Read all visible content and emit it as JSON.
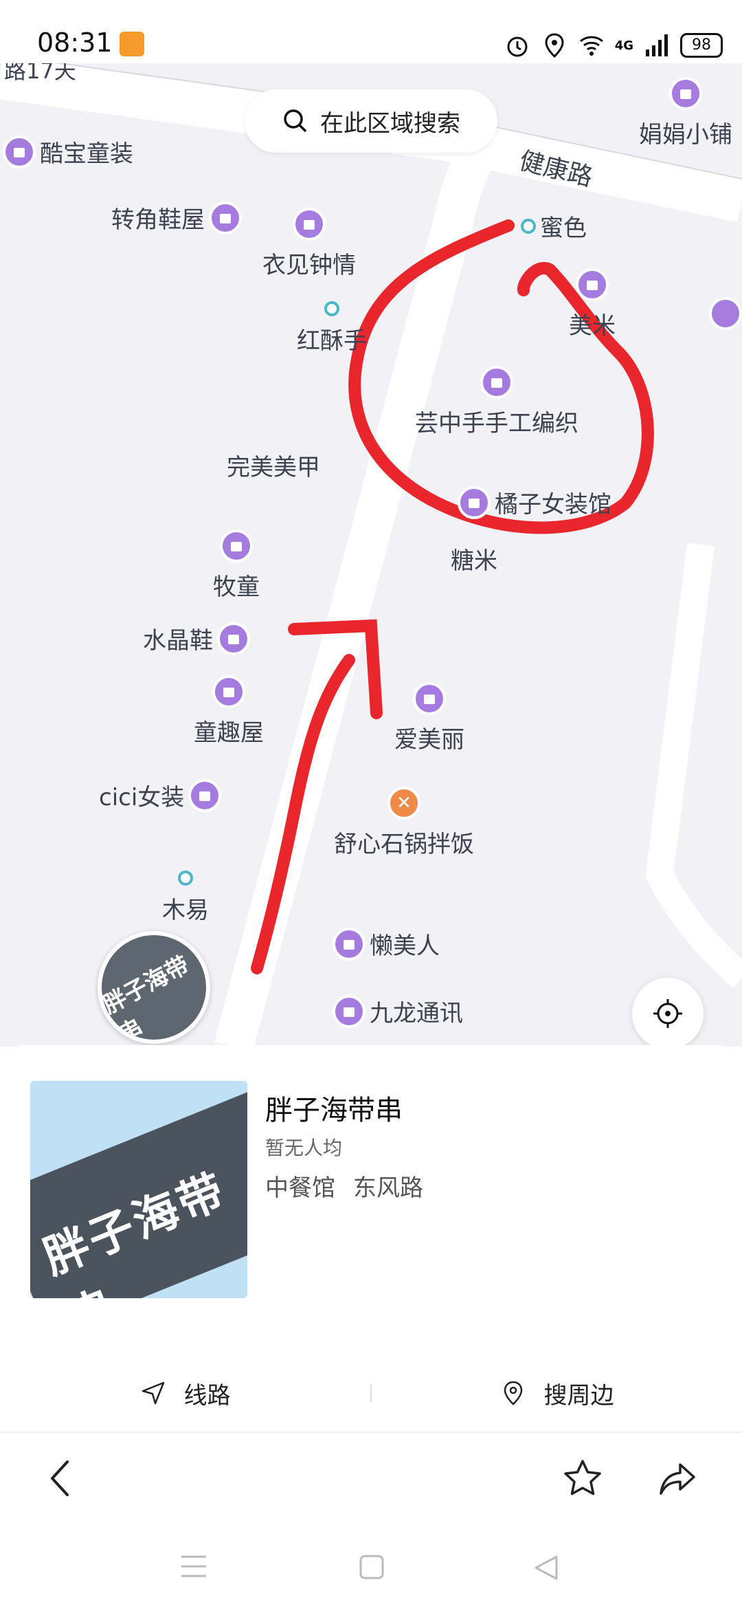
{
  "status_bar": {
    "time": "08:31",
    "network": "4G",
    "battery": "98"
  },
  "map": {
    "search_button_label": "在此区域搜索",
    "roads": {
      "top_left_partial": "路17天",
      "jiankang": "健康路"
    },
    "pois": [
      {
        "id": "kubao",
        "name": "酷宝童装",
        "type": "shop"
      },
      {
        "id": "juanjuan",
        "name": "娟娟小铺",
        "type": "shop"
      },
      {
        "id": "zhuanjiao",
        "name": "转角鞋屋",
        "type": "shop"
      },
      {
        "id": "yijian",
        "name": "衣见钟情",
        "type": "shop"
      },
      {
        "id": "mise",
        "name": "蜜色",
        "type": "place"
      },
      {
        "id": "hongsu",
        "name": "红酥手",
        "type": "place"
      },
      {
        "id": "meiyi",
        "name": "美米",
        "type": "shop"
      },
      {
        "id": "yunzhong",
        "name": "芸中手手工编织",
        "type": "shop"
      },
      {
        "id": "wanmei",
        "name": "完美美甲",
        "type": "text"
      },
      {
        "id": "juzi",
        "name": "橘子女装馆",
        "type": "shop"
      },
      {
        "id": "tangmi",
        "name": "糖米",
        "type": "text"
      },
      {
        "id": "mutong",
        "name": "牧童",
        "type": "shop"
      },
      {
        "id": "shuijing",
        "name": "水晶鞋",
        "type": "shop"
      },
      {
        "id": "tongqu",
        "name": "童趣屋",
        "type": "shop"
      },
      {
        "id": "aimeili",
        "name": "爱美丽",
        "type": "shop"
      },
      {
        "id": "cici",
        "name": "cici女装",
        "type": "shop"
      },
      {
        "id": "shuxin",
        "name": "舒心石锅拌饭",
        "type": "restaurant"
      },
      {
        "id": "muyi",
        "name": "木易",
        "type": "place"
      },
      {
        "id": "lanmeiren",
        "name": "懒美人",
        "type": "shop"
      },
      {
        "id": "jiulong",
        "name": "九龙通讯",
        "type": "shop"
      }
    ],
    "selected_pin_label": "胖子海带串"
  },
  "place": {
    "name": "胖子海带串",
    "price": "暂无人均",
    "category": "中餐馆",
    "road": "东风路",
    "photo_sign_text": "胖子海带串"
  },
  "actions": {
    "route": "线路",
    "nearby": "搜周边"
  },
  "colors": {
    "shop_pin": "#a67be0",
    "food_pin": "#f08a4b",
    "annotation": "#e8262b",
    "map_bg": "#f2f2f6"
  }
}
